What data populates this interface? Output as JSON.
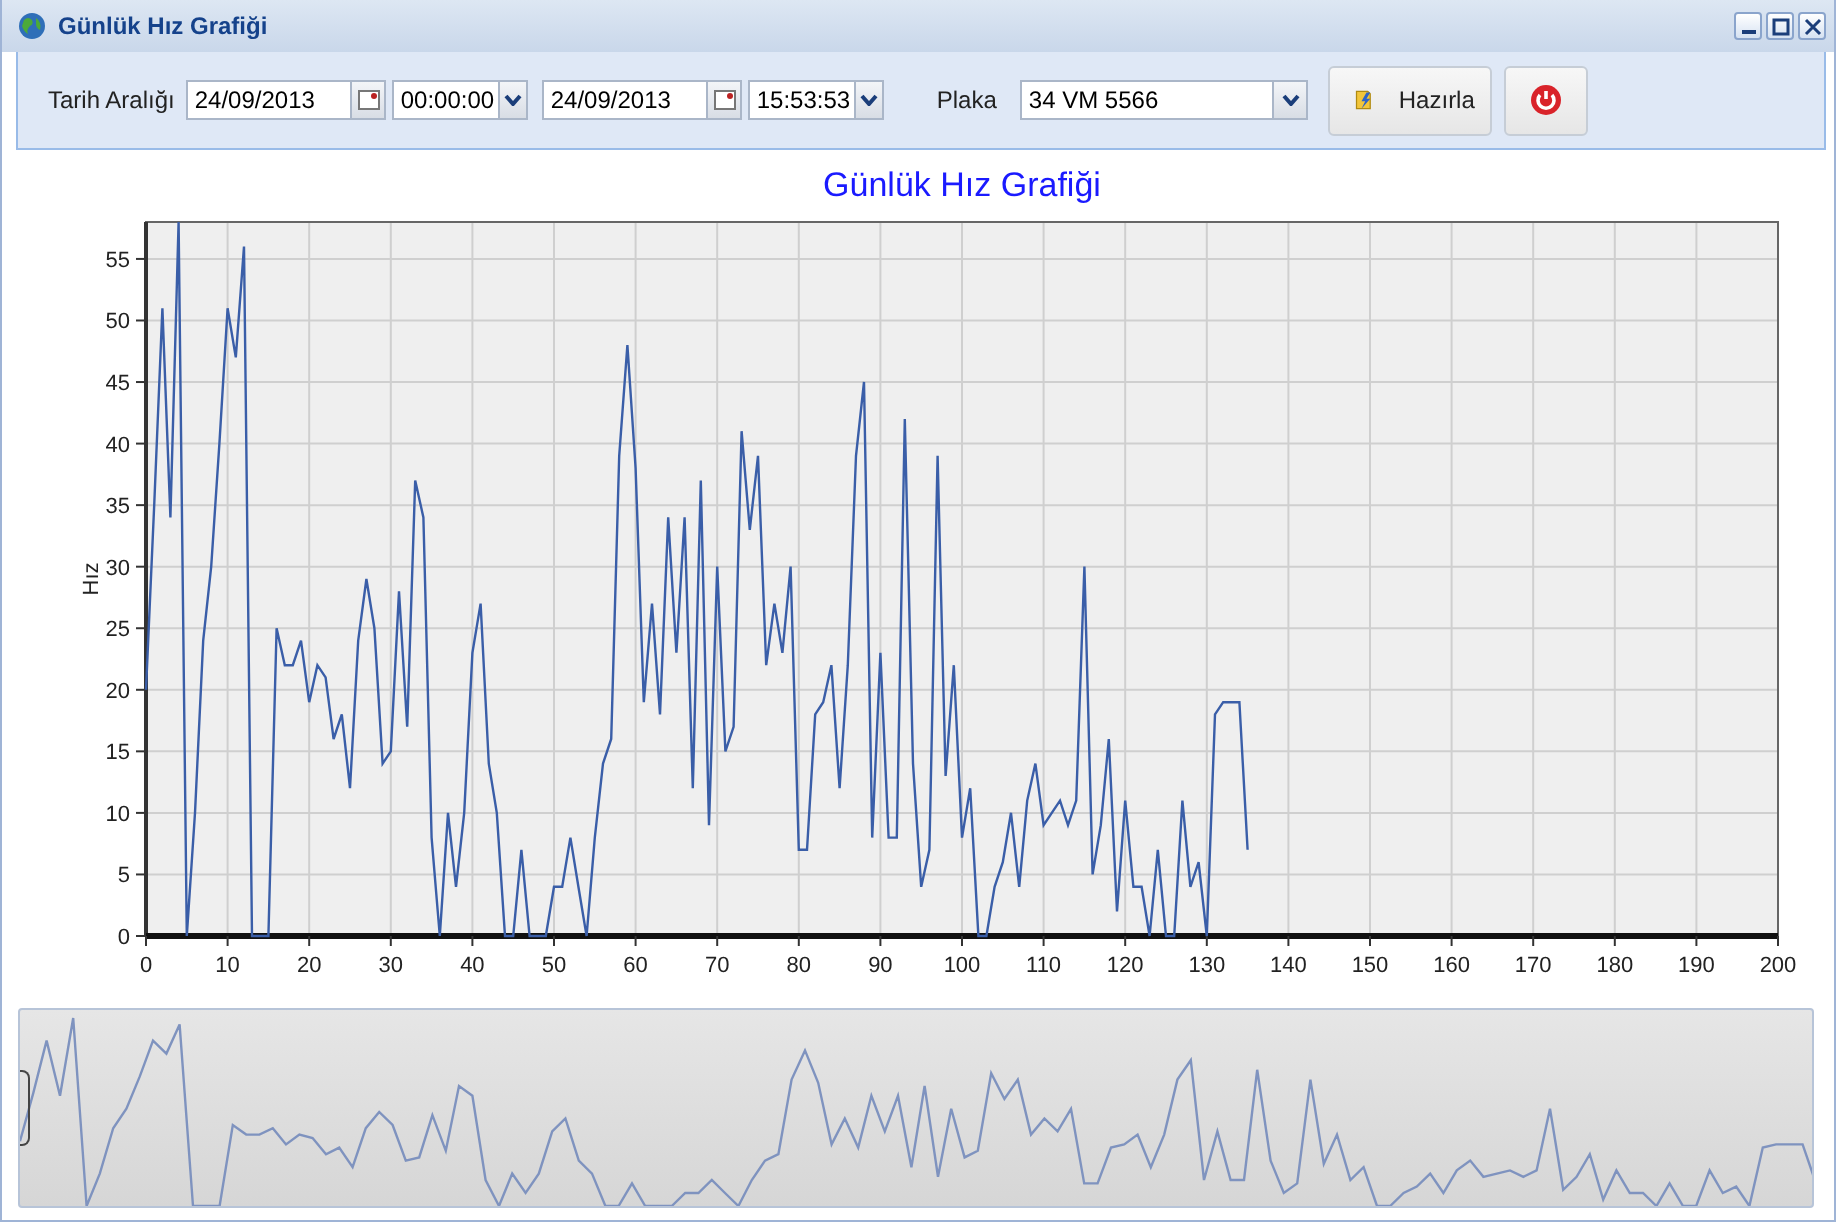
{
  "window": {
    "title": "Günlük Hız Grafiği"
  },
  "toolbar": {
    "range_label": "Tarih Aralığı",
    "start_date": "24/09/2013",
    "start_time": "00:00:00",
    "end_date": "24/09/2013",
    "end_time": "15:53:53",
    "plate_label": "Plaka",
    "plate": "34 VM 5566",
    "buttons": [
      {
        "kind": "prepare",
        "label": "Hazırla"
      },
      {
        "kind": "exit"
      }
    ]
  },
  "chart": {
    "chart_data": {
      "type": "line",
      "title": "Günlük Hız Grafiği",
      "ylabel": "Hız",
      "x": [
        0,
        1,
        2,
        3,
        4,
        5,
        6,
        7,
        8,
        9,
        10,
        11,
        12,
        13,
        14,
        15,
        16,
        17,
        18,
        19,
        20,
        21,
        22,
        23,
        24,
        25,
        26,
        27,
        28,
        29,
        30,
        31,
        32,
        33,
        34,
        35,
        36,
        37,
        38,
        39,
        40,
        41,
        42,
        43,
        44,
        45,
        46,
        47,
        48,
        49,
        50,
        51,
        52,
        53,
        54,
        55,
        56,
        57,
        58,
        59,
        60,
        61,
        62,
        63,
        64,
        65,
        66,
        67,
        68,
        69,
        70,
        71,
        72,
        73,
        74,
        75,
        76,
        77,
        78,
        79,
        80,
        81,
        82,
        83,
        84,
        85,
        86,
        87,
        88,
        89,
        90,
        91,
        92,
        93,
        94,
        95,
        96,
        97,
        98,
        99,
        100,
        101,
        102,
        103,
        104,
        105,
        106,
        107,
        108,
        109,
        110,
        111,
        112,
        113,
        114,
        115,
        116,
        117,
        118,
        119,
        120,
        121,
        122,
        123,
        124,
        125,
        126,
        127,
        128,
        129,
        130,
        131,
        132,
        133,
        134,
        135
      ],
      "series": [
        {
          "color": "#3a5ea8",
          "values": [
            20,
            35,
            51,
            34,
            58,
            0,
            10,
            24,
            30,
            40,
            51,
            47,
            56,
            0,
            0,
            0,
            25,
            22,
            22,
            24,
            19,
            22,
            21,
            16,
            18,
            12,
            24,
            29,
            25,
            14,
            15,
            28,
            17,
            37,
            34,
            8,
            0,
            10,
            4,
            10,
            23,
            27,
            14,
            10,
            0,
            0,
            7,
            0,
            0,
            0,
            4,
            4,
            8,
            4,
            0,
            8,
            14,
            16,
            39,
            48,
            38,
            19,
            27,
            18,
            34,
            23,
            34,
            12,
            37,
            9,
            30,
            15,
            17,
            41,
            33,
            39,
            22,
            27,
            23,
            30,
            7,
            7,
            18,
            19,
            22,
            12,
            22,
            39,
            45,
            8,
            23,
            8,
            8,
            42,
            14,
            4,
            7,
            39,
            13,
            22,
            8,
            12,
            0,
            0,
            4,
            6,
            10,
            4,
            11,
            14,
            9,
            10,
            11,
            9,
            11,
            30,
            5,
            9,
            16,
            2,
            11,
            4,
            4,
            0,
            7,
            0,
            0,
            11,
            4,
            6,
            0,
            18,
            19,
            19,
            19,
            7
          ]
        }
      ],
      "grid": true,
      "xlim": [
        0,
        200
      ],
      "ylim": [
        0,
        58
      ],
      "xticks": [
        0,
        10,
        20,
        30,
        40,
        50,
        60,
        70,
        80,
        90,
        100,
        110,
        120,
        130,
        140,
        150,
        160,
        170,
        180,
        190,
        200
      ],
      "yticks": [
        0,
        5,
        10,
        15,
        20,
        25,
        30,
        35,
        40,
        45,
        50,
        55
      ]
    }
  }
}
